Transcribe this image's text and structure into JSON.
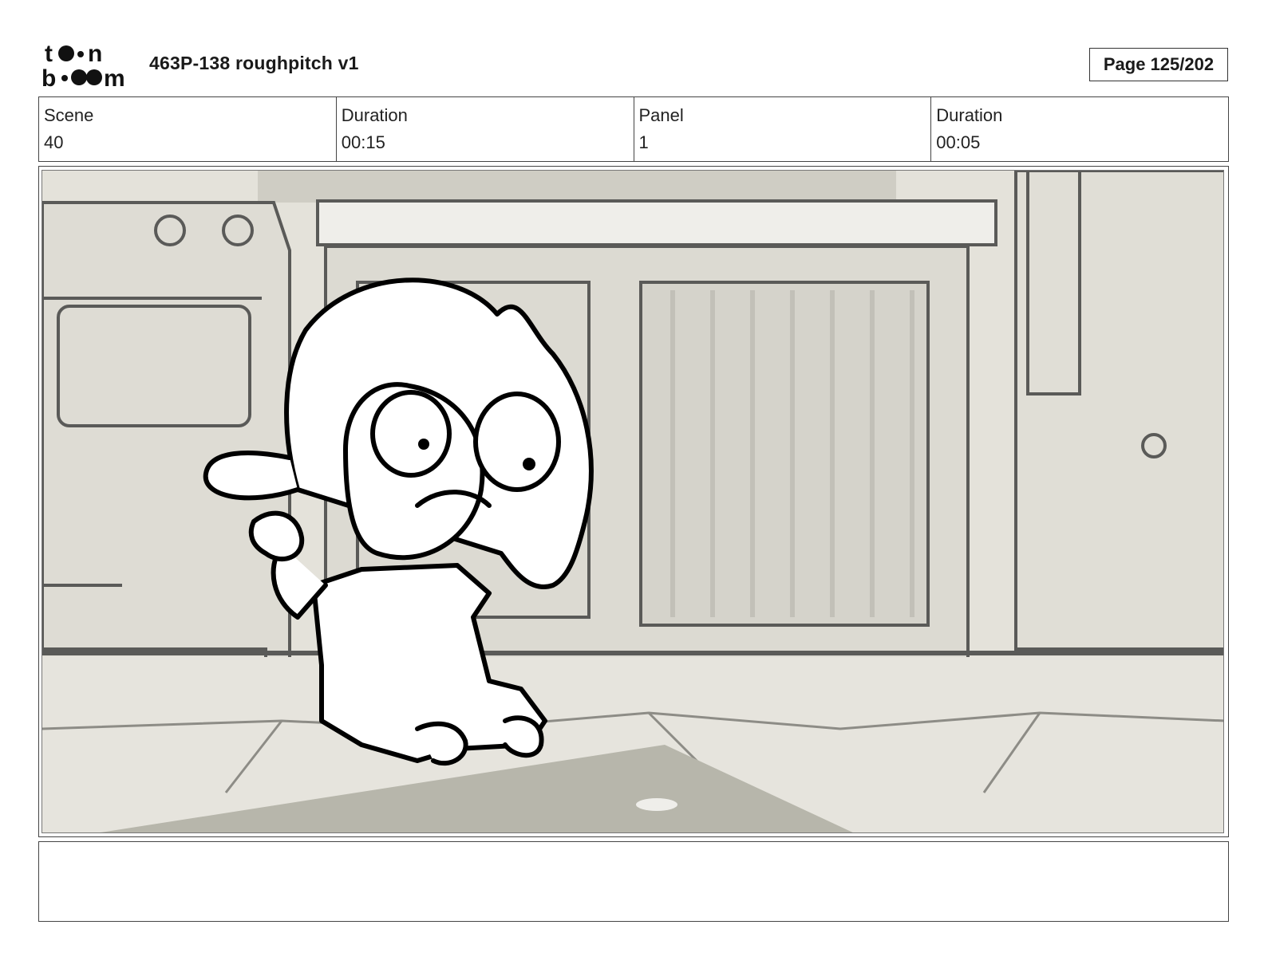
{
  "header": {
    "logo_text": "toon boom",
    "title": "463P-138 roughpitch v1",
    "page_label": "Page 125/202"
  },
  "info": {
    "scene_label": "Scene",
    "scene_value": "40",
    "scene_duration_label": "Duration",
    "scene_duration_value": "00:15",
    "panel_label": "Panel",
    "panel_value": "1",
    "panel_duration_label": "Duration",
    "panel_duration_value": "00:05"
  },
  "notes": {
    "text": ""
  },
  "colors": {
    "background_wall": "#e4e2da",
    "cabinet": "#dcdad2",
    "floor": "#e6e4dd",
    "rug": "#b7b6ab",
    "line": "#5a5a58",
    "ink": "#000000"
  }
}
